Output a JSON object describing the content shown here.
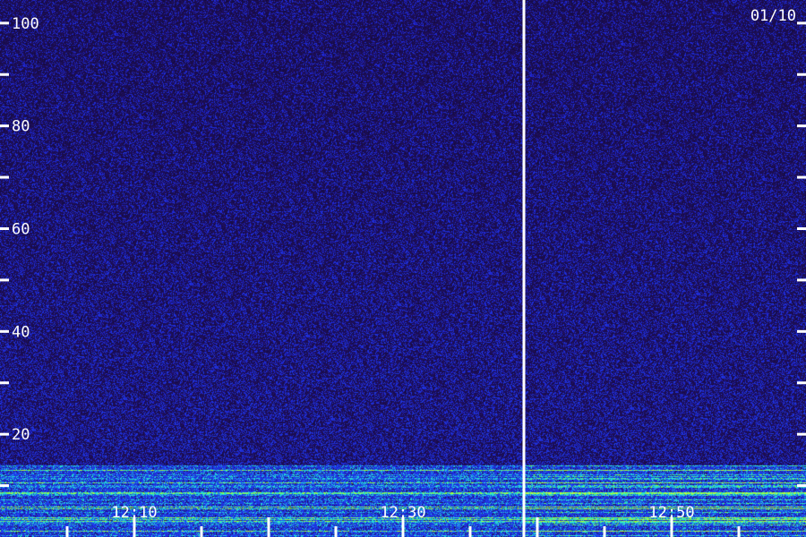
{
  "chart_data": {
    "type": "heatmap",
    "title": "",
    "date_label": "01/10",
    "y_ticks": [
      {
        "value": 100,
        "label": "100"
      },
      {
        "value": 90,
        "label": ""
      },
      {
        "value": 80,
        "label": "80"
      },
      {
        "value": 70,
        "label": ""
      },
      {
        "value": 60,
        "label": "60"
      },
      {
        "value": 50,
        "label": ""
      },
      {
        "value": 40,
        "label": "40"
      },
      {
        "value": 30,
        "label": ""
      },
      {
        "value": 20,
        "label": "20"
      },
      {
        "value": 10,
        "label": ""
      }
    ],
    "ylim": [
      0,
      104.5
    ],
    "x_minutes_range": [
      "12:00",
      "13:00"
    ],
    "x_ticks": [
      {
        "time": "12:10",
        "label": "12:10"
      },
      {
        "time": "12:30",
        "label": "12:30"
      },
      {
        "time": "12:50",
        "label": "12:50"
      }
    ],
    "x_minor_ticks": [
      "12:05",
      "12:10",
      "12:15",
      "12:20",
      "12:25",
      "12:30",
      "12:35",
      "12:40",
      "12:45",
      "12:50",
      "12:55"
    ],
    "marker_time": "12:39",
    "background_color": "#1c0e52",
    "band_colors": [
      "#1e3cff",
      "#27e0c8",
      "#9cff3a"
    ],
    "low_band_top": 14
  }
}
